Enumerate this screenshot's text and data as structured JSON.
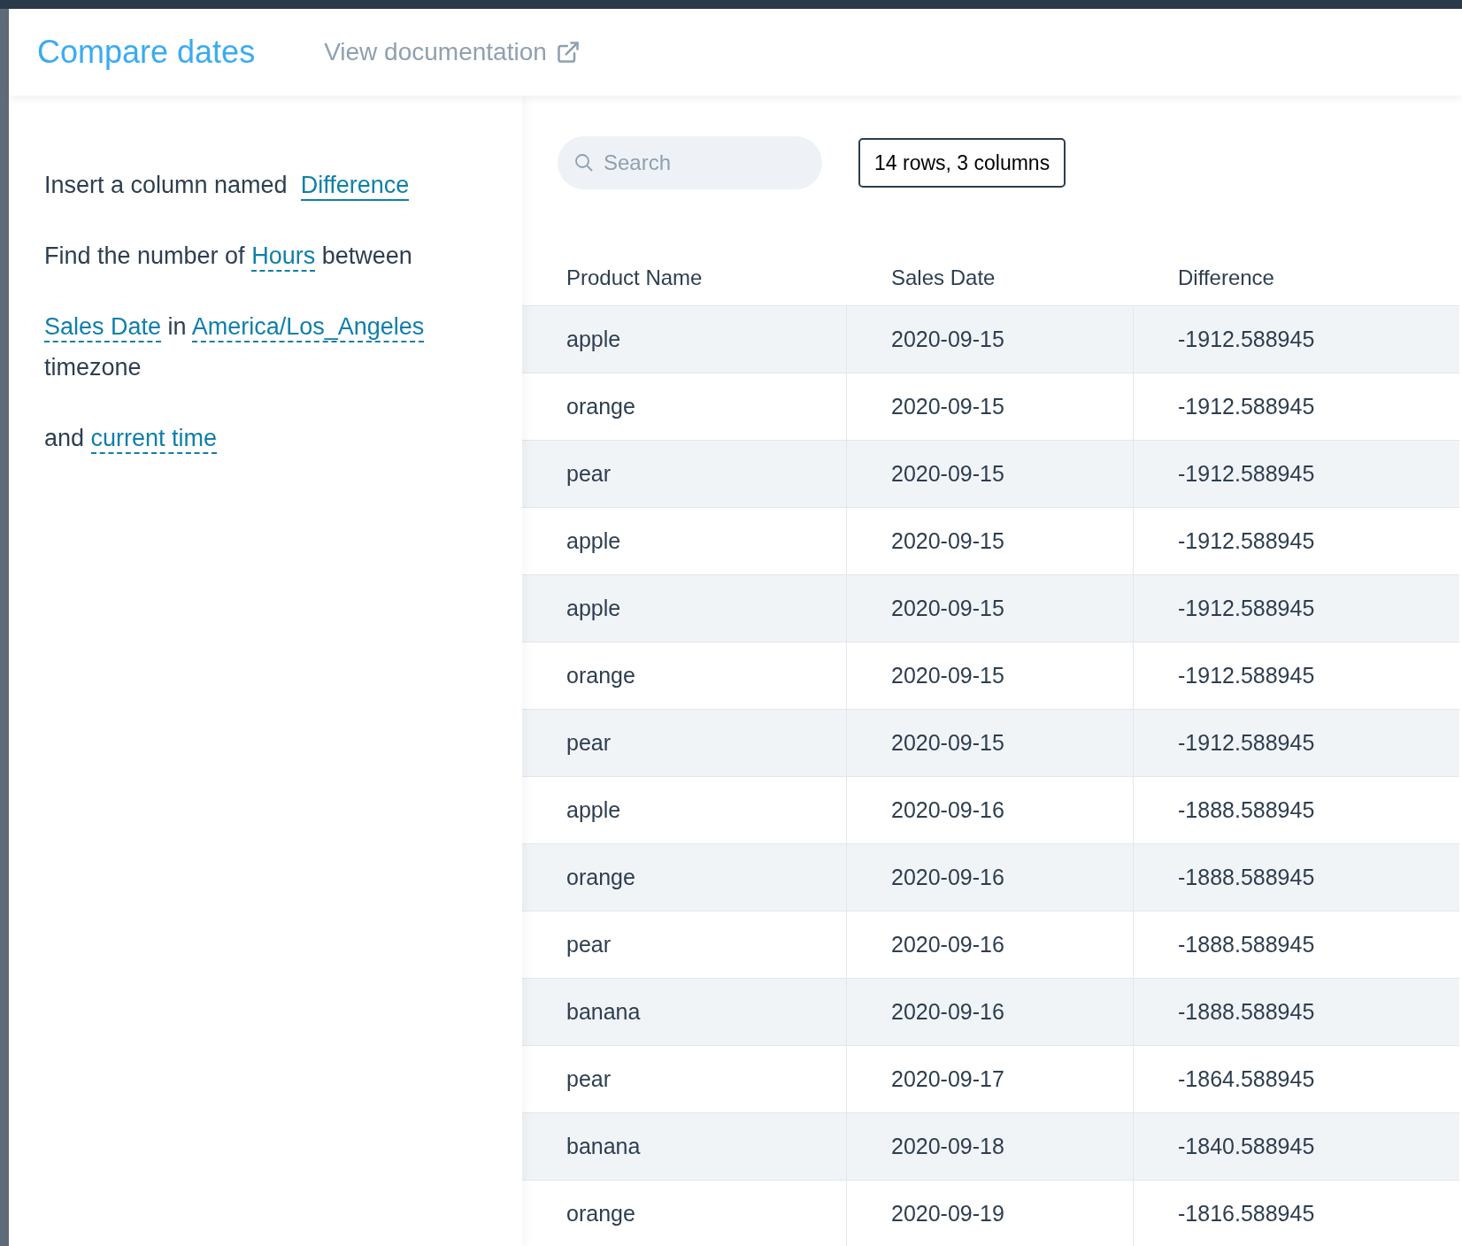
{
  "header": {
    "title": "Compare dates",
    "doc_link": "View documentation"
  },
  "instructions": [
    [
      {
        "text": "Insert a column named",
        "kind": "plain"
      },
      {
        "text": "Difference",
        "kind": "field"
      }
    ],
    [
      {
        "text": "Find the number of",
        "kind": "plain"
      },
      {
        "text": "Hours",
        "kind": "option"
      },
      {
        "text": "between",
        "kind": "plain"
      }
    ],
    [
      {
        "text": "Sales Date",
        "kind": "option"
      },
      {
        "text": "in",
        "kind": "plain"
      },
      {
        "text": "America/Los_Angeles",
        "kind": "option"
      },
      {
        "text": "timezone",
        "kind": "plain"
      }
    ],
    [
      {
        "text": "and",
        "kind": "plain"
      },
      {
        "text": "current time",
        "kind": "option"
      }
    ]
  ],
  "search": {
    "placeholder": "Search"
  },
  "table_summary": "14 rows, 3 columns",
  "table": {
    "columns": [
      "Product Name",
      "Sales Date",
      "Difference"
    ],
    "rows": [
      [
        "apple",
        "2020-09-15",
        "-1912.588945"
      ],
      [
        "orange",
        "2020-09-15",
        "-1912.588945"
      ],
      [
        "pear",
        "2020-09-15",
        "-1912.588945"
      ],
      [
        "apple",
        "2020-09-15",
        "-1912.588945"
      ],
      [
        "apple",
        "2020-09-15",
        "-1912.588945"
      ],
      [
        "orange",
        "2020-09-15",
        "-1912.588945"
      ],
      [
        "pear",
        "2020-09-15",
        "-1912.588945"
      ],
      [
        "apple",
        "2020-09-16",
        "-1888.588945"
      ],
      [
        "orange",
        "2020-09-16",
        "-1888.588945"
      ],
      [
        "pear",
        "2020-09-16",
        "-1888.588945"
      ],
      [
        "banana",
        "2020-09-16",
        "-1888.588945"
      ],
      [
        "pear",
        "2020-09-17",
        "-1864.588945"
      ],
      [
        "banana",
        "2020-09-18",
        "-1840.588945"
      ],
      [
        "orange",
        "2020-09-19",
        "-1816.588945"
      ]
    ]
  }
}
